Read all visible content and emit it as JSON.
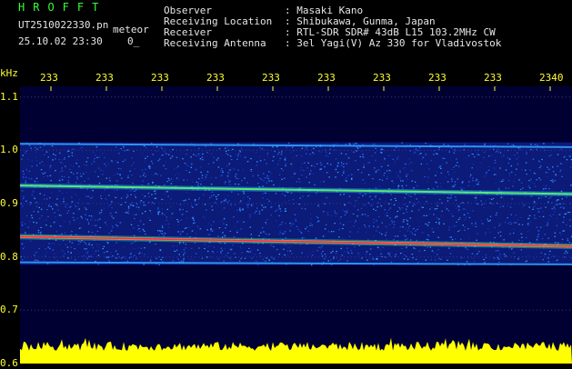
{
  "header": {
    "app_title": "HROFFT",
    "filename": "UT2510022330.pn",
    "mode": "meteor",
    "datetime": "25.10.02 23:30",
    "counter": "0_",
    "info": [
      {
        "label": "Observer",
        "value": ": Masaki Kano"
      },
      {
        "label": "Receiving Location",
        "value": ": Shibukawa, Gunma, Japan"
      },
      {
        "label": "Receiver",
        "value": ": RTL-SDR SDR# 43dB L15 103.2MHz CW"
      },
      {
        "label": "Receiving Antenna",
        "value": ": 3el Yagi(V) Az 330 for Vladivostok"
      }
    ]
  },
  "chart_data": {
    "type": "heatmap",
    "ylabel": "kHz",
    "y_ticks": [
      "1.1",
      "1.0",
      "0.9",
      "0.8",
      "0.7",
      "0.6"
    ],
    "x_ticks": [
      "233",
      "233",
      "233",
      "233",
      "233",
      "233",
      "233",
      "233",
      "233",
      "2340"
    ],
    "ylim": [
      0.6,
      1.12
    ],
    "bands": [
      {
        "freq_start": 0.838,
        "freq_end": 0.82,
        "strength": 1.0
      },
      {
        "freq_start": 0.934,
        "freq_end": 0.918,
        "strength": 0.75
      },
      {
        "freq_start": 1.012,
        "freq_end": 1.006,
        "strength": 0.5
      },
      {
        "freq_start": 0.79,
        "freq_end": 0.786,
        "strength": 0.4
      }
    ],
    "noise_band": [
      0.785,
      1.015
    ],
    "colors": {
      "background": "#000033",
      "grid": "#3a3a7a",
      "tick": "#ffff33",
      "level": "#ffff00"
    }
  }
}
